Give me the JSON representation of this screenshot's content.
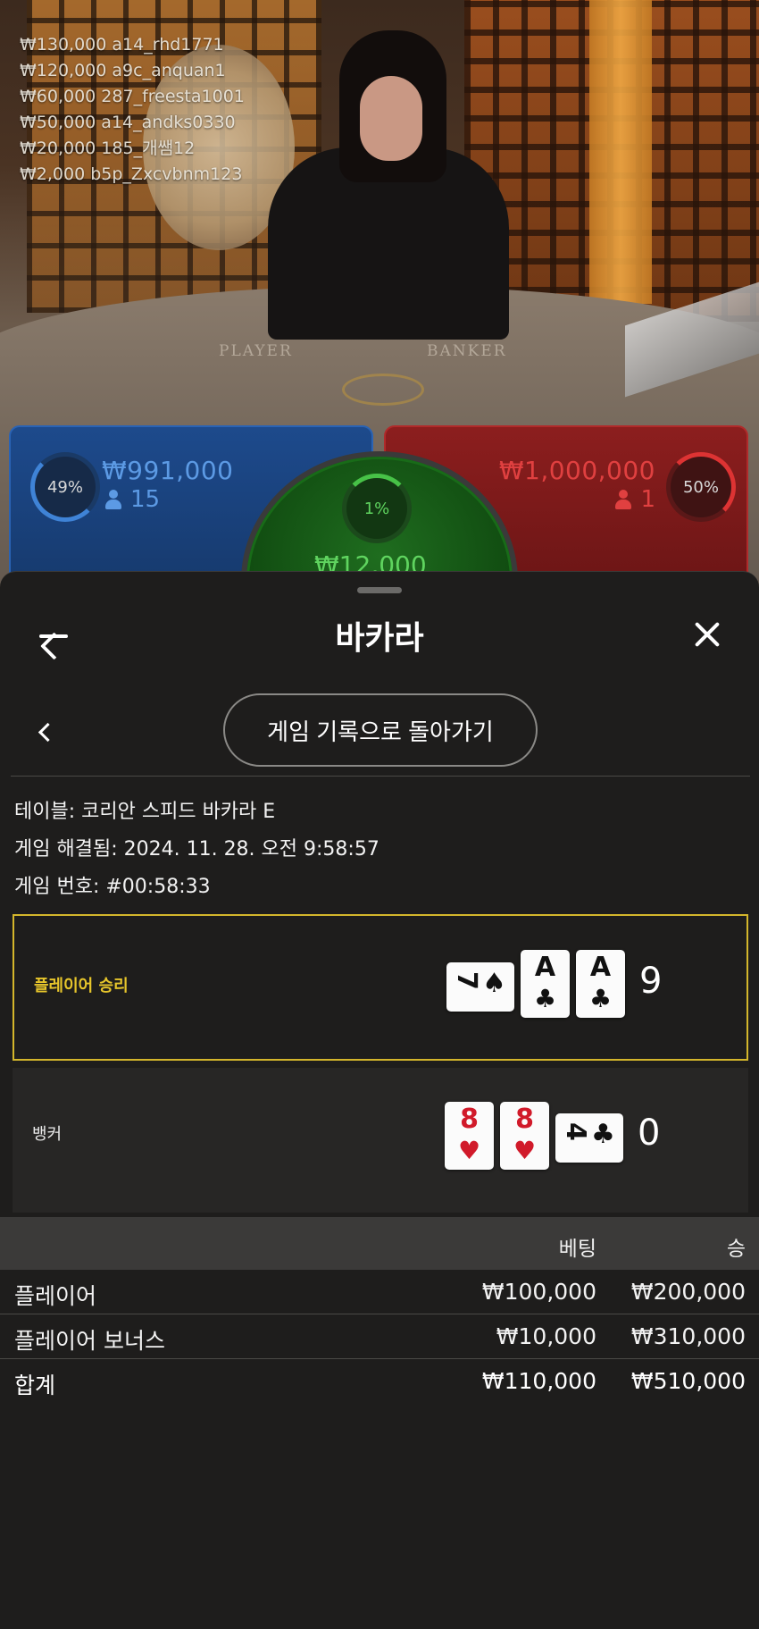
{
  "feed": {
    "rows": [
      {
        "text": "₩130,000  a14_rhd1771"
      },
      {
        "text": "₩120,000  a9c_anquan1"
      },
      {
        "text": "₩60,000  287_freesta1001"
      },
      {
        "text": "₩50,000  a14_andks0330"
      },
      {
        "text": "₩20,000  185_개쌤12"
      },
      {
        "text": "₩2,000  b5p_Zxcvbnm123"
      }
    ]
  },
  "table_felt": {
    "player": "PLAYER",
    "banker": "BANKER"
  },
  "bet_spots": {
    "player": {
      "percent": "49%",
      "amount": "₩991,000",
      "players": "15",
      "color": "#5c9ae4"
    },
    "banker": {
      "percent": "50%",
      "amount": "₩1,000,000",
      "players": "1",
      "color": "#e04040"
    },
    "tie": {
      "percent": "1%",
      "amount": "₩12,000",
      "color": "#5fd45f"
    }
  },
  "sheet": {
    "title": "바카라",
    "back_icon": "arrow-left-icon",
    "close_icon": "close-icon",
    "history_button": "게임 기록으로 돌아가기",
    "meta": {
      "table_label": "테이블:",
      "table_value": "코리안 스피드 바카라 E",
      "resolved_label": "게임 해결됨:",
      "resolved_value": "2024. 11. 28. 오전 9:58:57",
      "number_label": "게임 번호:",
      "number_value": "#00:58:33"
    },
    "result": {
      "player": {
        "label": "플레이어 승리",
        "score": "9",
        "cards": [
          {
            "rank": "7",
            "suit": "♠",
            "orientation": "side"
          },
          {
            "rank": "A",
            "suit": "♣",
            "orientation": "upright"
          },
          {
            "rank": "A",
            "suit": "♣",
            "orientation": "upright"
          }
        ]
      },
      "banker": {
        "label": "뱅커",
        "score": "0",
        "cards": [
          {
            "rank": "8",
            "suit": "♥",
            "orientation": "upright"
          },
          {
            "rank": "8",
            "suit": "♥",
            "orientation": "upright"
          },
          {
            "rank": "4",
            "suit": "♣",
            "orientation": "side"
          }
        ]
      },
      "win_color": "#e6c52b"
    },
    "bets": {
      "headers": {
        "bet": "베팅",
        "win": "승"
      },
      "rows": [
        {
          "name": "플레이어",
          "bet": "₩100,000",
          "win": "₩200,000"
        },
        {
          "name": "플레이어 보너스",
          "bet": "₩10,000",
          "win": "₩310,000"
        }
      ],
      "total": {
        "name": "합계",
        "bet": "₩110,000",
        "win": "₩510,000"
      }
    }
  }
}
